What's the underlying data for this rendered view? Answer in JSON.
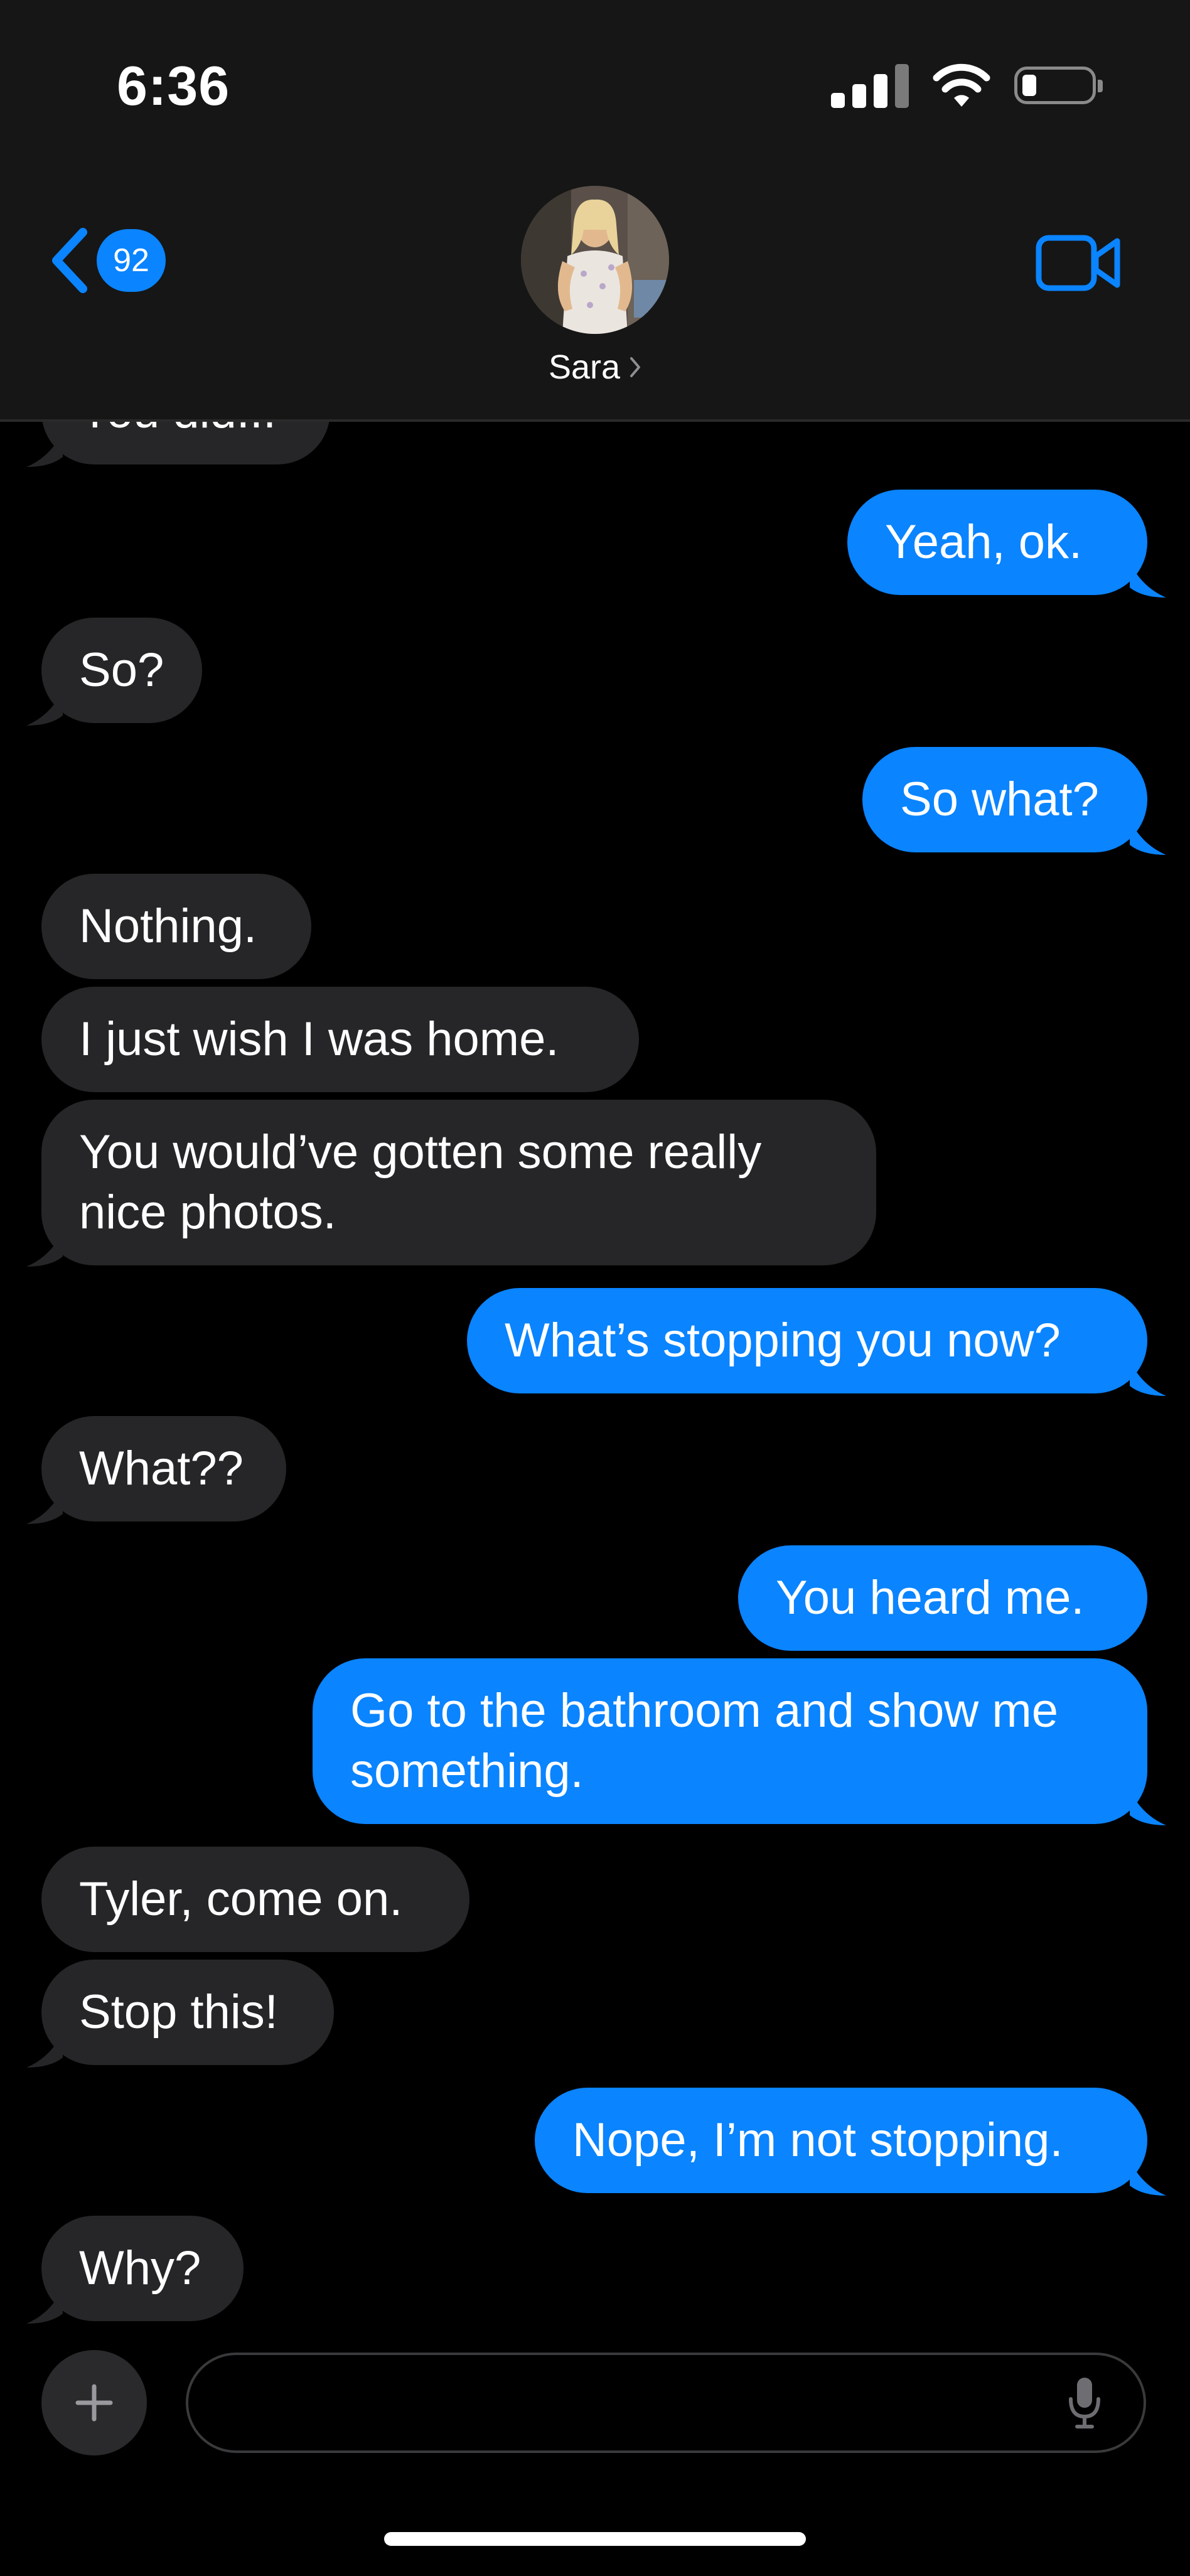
{
  "status": {
    "time": "6:36"
  },
  "header": {
    "back_count": "92",
    "contact_name": "Sara"
  },
  "messages": [
    {
      "side": "received",
      "text": "You did..."
    },
    {
      "side": "sent",
      "text": "Yeah, ok."
    },
    {
      "side": "received",
      "text": "So?"
    },
    {
      "side": "sent",
      "text": "So what?"
    },
    {
      "side": "received",
      "text": "Nothing."
    },
    {
      "side": "received",
      "text": "I just wish I was home."
    },
    {
      "side": "received",
      "text": "You would’ve gotten some really nice photos."
    },
    {
      "side": "sent",
      "text": "What’s stopping you now?"
    },
    {
      "side": "received",
      "text": "What??"
    },
    {
      "side": "sent",
      "text": "You heard me."
    },
    {
      "side": "sent",
      "text": "Go to the bathroom and show me something."
    },
    {
      "side": "received",
      "text": "Tyler, come on."
    },
    {
      "side": "received",
      "text": "Stop this!"
    },
    {
      "side": "sent",
      "text": "Nope, I’m not stopping."
    },
    {
      "side": "received",
      "text": "Why?"
    }
  ],
  "input": {
    "placeholder": ""
  },
  "icons": {
    "back": "chevron-left-icon",
    "video": "video-camera-icon",
    "plus": "plus-icon",
    "mic": "microphone-icon",
    "signal": "cellular-signal-icon",
    "wifi": "wifi-icon",
    "battery": "battery-icon"
  },
  "colors": {
    "accent": "#0a84ff",
    "received_bubble": "#262628",
    "background": "#000000",
    "header_background": "#161616"
  }
}
